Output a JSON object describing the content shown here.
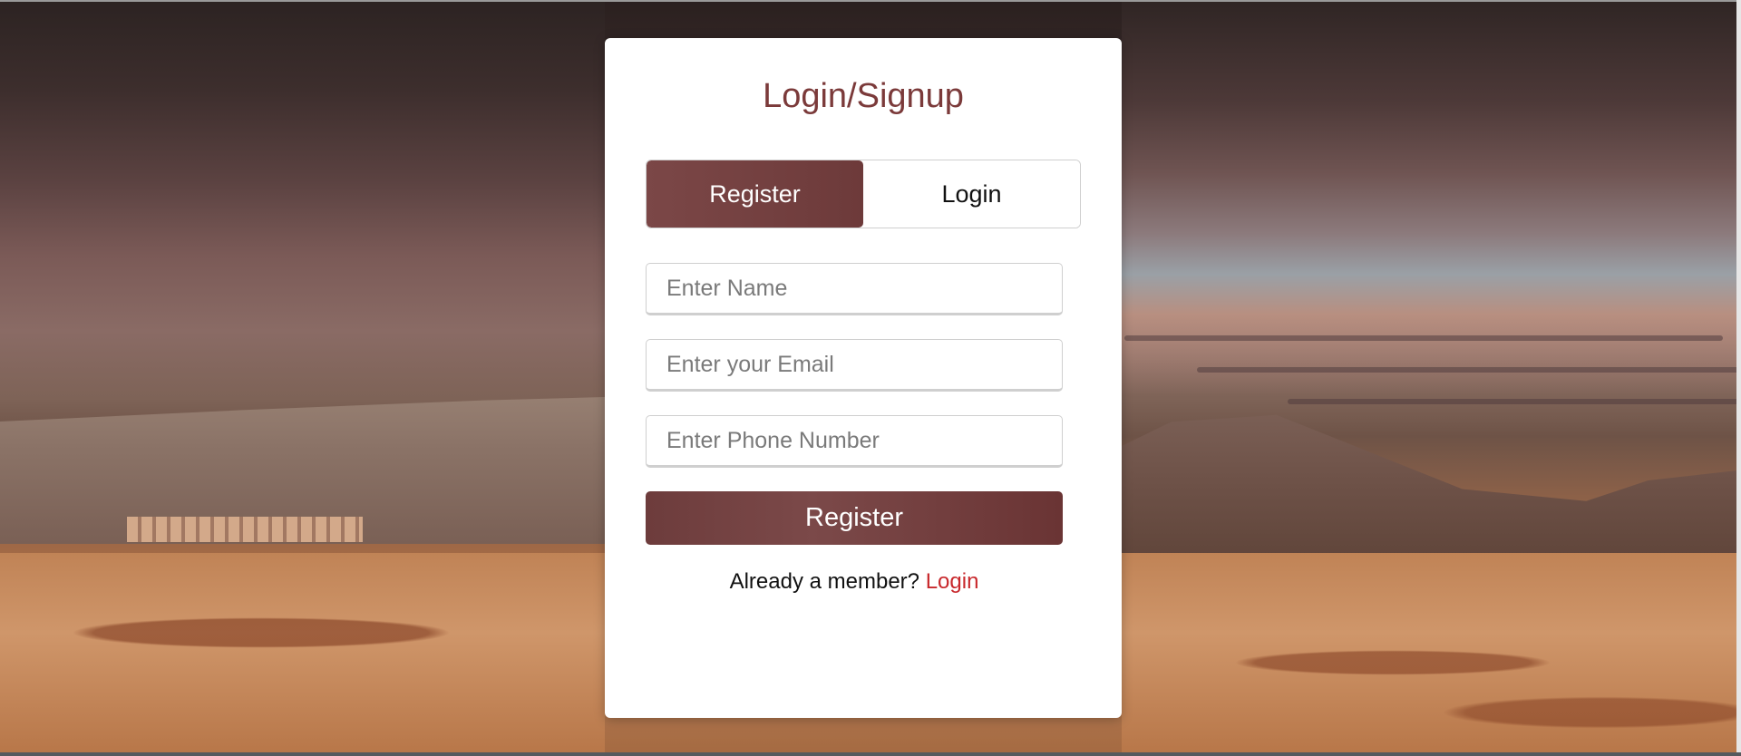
{
  "form": {
    "title": "Login/Signup",
    "tabs": [
      {
        "label": "Register",
        "active": true
      },
      {
        "label": "Login",
        "active": false
      }
    ],
    "fields": {
      "name_placeholder": "Enter Name",
      "email_placeholder": "Enter your Email",
      "phone_placeholder": "Enter Phone Number"
    },
    "submit_label": "Register",
    "footer": {
      "prompt": "Already a member?",
      "link_label": "Login"
    }
  },
  "colors": {
    "accent": "#6d3a3a",
    "title": "#7b3a3a",
    "link": "#c8282c"
  }
}
